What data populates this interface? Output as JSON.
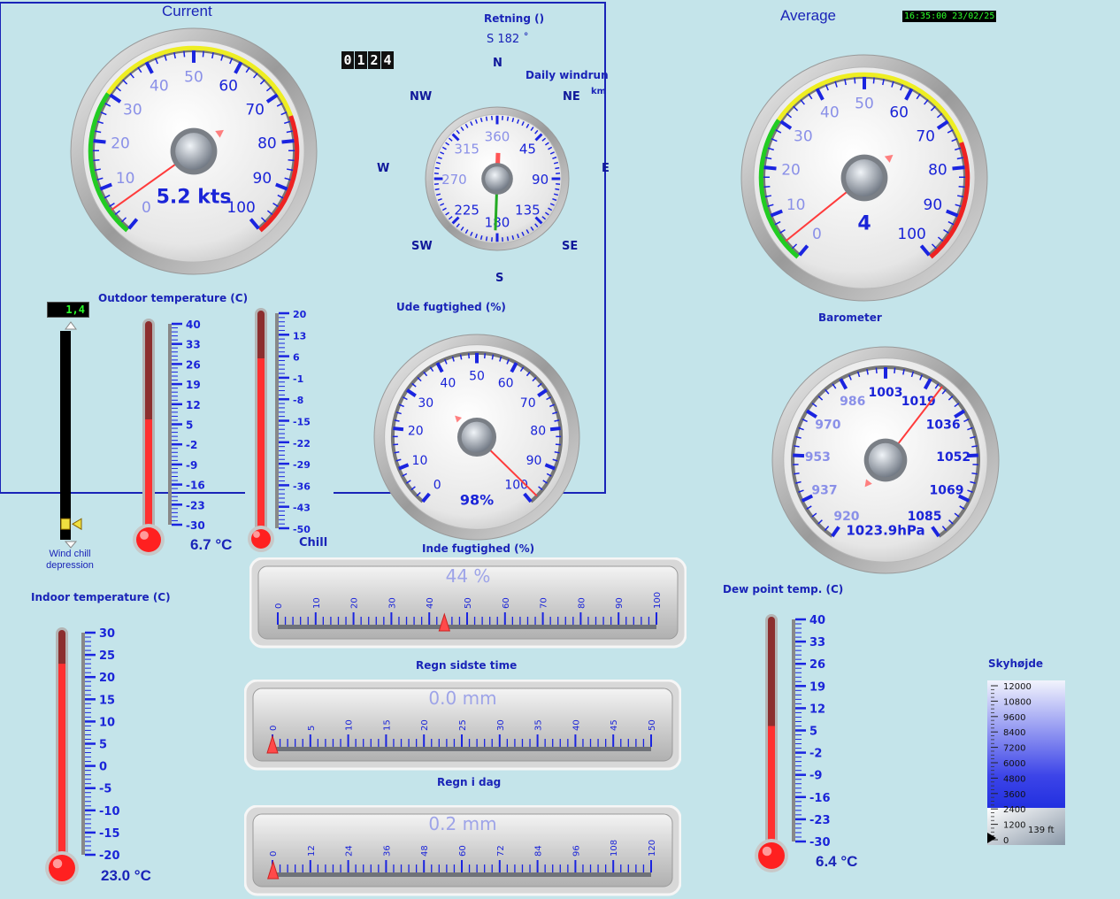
{
  "colors": {
    "accent": "#1a24b8",
    "background": "#c4e4ea",
    "needle": "#ff3b3b",
    "lcd_text": "#2bff2b"
  },
  "header": {
    "current_title": "Current",
    "average_title": "Average",
    "clock": "16:35:00 23/02/25"
  },
  "wind_direction": {
    "label": "Retning ()",
    "reading": "S  182 ˚",
    "degrees": 182,
    "directions": {
      "n": "N",
      "ne": "NE",
      "e": "E",
      "se": "SE",
      "s": "S",
      "sw": "SW",
      "w": "W",
      "nw": "NW"
    },
    "dial_ticks": [
      "360",
      "45",
      "90",
      "135",
      "180",
      "225",
      "270",
      "315"
    ]
  },
  "windrun": {
    "label": "Daily windrun",
    "unit": "km",
    "digits": [
      "0",
      "1",
      "2",
      "4"
    ]
  },
  "current_wind": {
    "ticks": [
      "0",
      "10",
      "20",
      "30",
      "40",
      "50",
      "60",
      "70",
      "80",
      "90",
      "100"
    ],
    "value": 5.2,
    "readout": "5.2 kts"
  },
  "average_wind": {
    "ticks": [
      "0",
      "10",
      "20",
      "30",
      "40",
      "50",
      "60",
      "70",
      "80",
      "90",
      "100"
    ],
    "value": 4,
    "readout": "4"
  },
  "outdoor_humidity": {
    "label": "Ude fugtighed (%)",
    "ticks": [
      "0",
      "10",
      "20",
      "30",
      "40",
      "50",
      "60",
      "70",
      "80",
      "90",
      "100"
    ],
    "value": 98,
    "readout": "98%"
  },
  "barometer": {
    "label": "Barometer",
    "ticks": [
      "920",
      "937",
      "953",
      "970",
      "986",
      "1003",
      "1019",
      "1036",
      "1052",
      "1069",
      "1085"
    ],
    "value": 1023.9,
    "readout": "1023.9hPa"
  },
  "wind_chill": {
    "lcd": "1,4",
    "label_line1": "Wind chill",
    "label_line2": "depression",
    "level": 0.05
  },
  "outdoor_temp": {
    "label": "Outdoor temperature (C)",
    "ticks": [
      "40",
      "33",
      "26",
      "19",
      "12",
      "5",
      "-2",
      "-9",
      "-16",
      "-23",
      "-30"
    ],
    "readout": "6.7 °C",
    "value": 6.7
  },
  "chill_temp": {
    "label": "Chill",
    "ticks": [
      "20",
      "13",
      "6",
      "-1",
      "-8",
      "-15",
      "-22",
      "-29",
      "-36",
      "-43",
      "-50"
    ],
    "value": 5.3
  },
  "indoor_temp": {
    "label": "Indoor temperature (C)",
    "ticks": [
      "30",
      "25",
      "20",
      "15",
      "10",
      "5",
      "0",
      "-5",
      "-10",
      "-15",
      "-20"
    ],
    "readout": "23.0 °C",
    "value": 23.0
  },
  "dew_point": {
    "label": "Dew point temp. (C)",
    "ticks": [
      "40",
      "33",
      "26",
      "19",
      "12",
      "5",
      "-2",
      "-9",
      "-16",
      "-23",
      "-30"
    ],
    "readout": "6.4 °C",
    "value": 6.4
  },
  "indoor_humidity": {
    "label": "Inde fugtighed (%)",
    "readout": "44 %",
    "ticks": [
      "0",
      "10",
      "20",
      "30",
      "40",
      "50",
      "60",
      "70",
      "80",
      "90",
      "100"
    ],
    "value": 44
  },
  "rain_hour": {
    "label": "Regn sidste time",
    "readout": "0.0 mm",
    "ticks": [
      "0",
      "5",
      "10",
      "15",
      "20",
      "25",
      "30",
      "35",
      "40",
      "45",
      "50"
    ],
    "value": 0
  },
  "rain_day": {
    "label": "Regn i dag",
    "readout": "0.2 mm",
    "ticks": [
      "0",
      "12",
      "24",
      "36",
      "48",
      "60",
      "72",
      "84",
      "96",
      "108",
      "120"
    ],
    "value": 0.2
  },
  "cloud_base": {
    "label": "Skyhøjde",
    "ticks": [
      "12000",
      "10800",
      "9600",
      "8400",
      "7200",
      "6000",
      "4800",
      "3600",
      "2400",
      "1200",
      "0"
    ],
    "readout": "139 ft",
    "value": 139
  }
}
